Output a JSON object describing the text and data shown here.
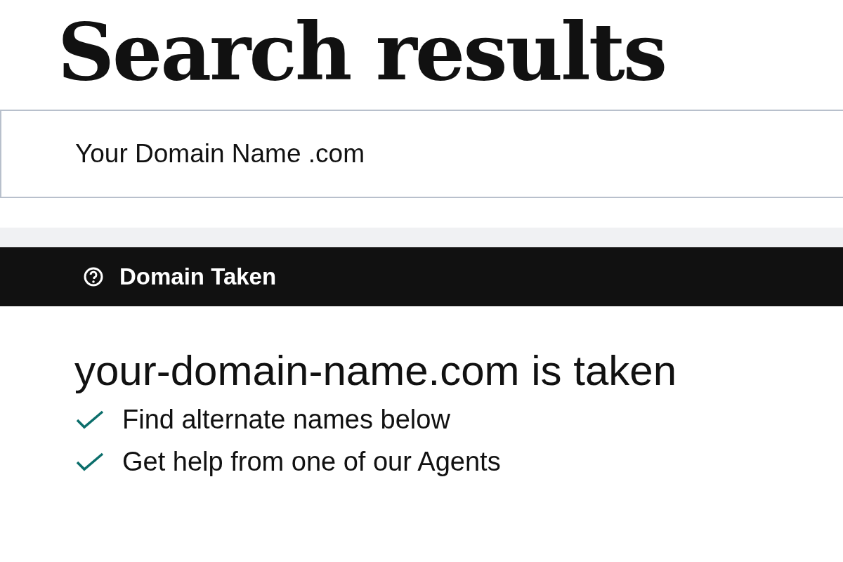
{
  "title": "Search results",
  "search": {
    "value": "Your Domain Name .com"
  },
  "banner": {
    "label": "Domain Taken"
  },
  "result": {
    "heading": "your-domain-name.com is taken",
    "items": [
      {
        "text": "Find alternate names below",
        "checked": true
      },
      {
        "text": "Get help from one of our Agents",
        "checked": true
      }
    ]
  }
}
